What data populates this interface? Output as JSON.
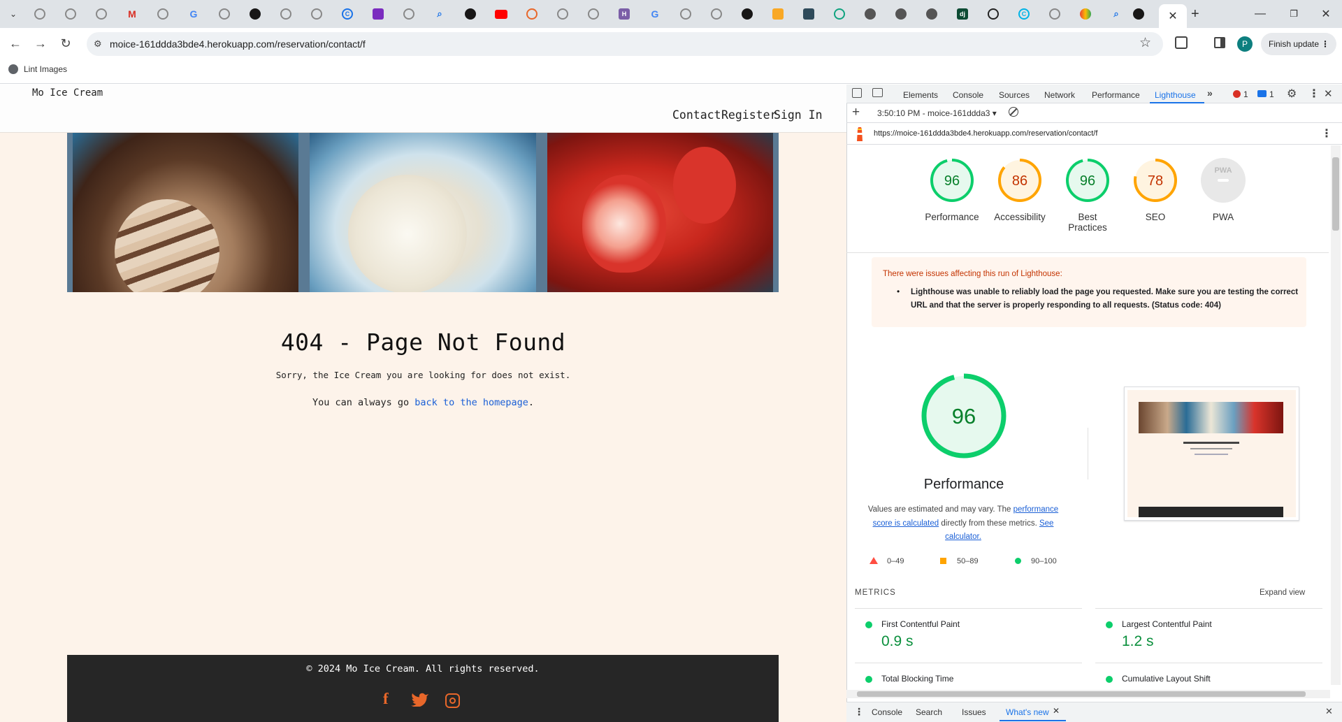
{
  "browser": {
    "url": "moice-161ddda3bde4.herokuapp.com/reservation/contact/f",
    "bookmark_label": "Lint Images",
    "finish_update_label": "Finish update",
    "profile_initial": "P"
  },
  "site": {
    "brand": "Mo Ice Cream",
    "nav": [
      "Contact",
      "Register",
      "Sign In"
    ],
    "heading": "404 - Page Not Found",
    "message": "Sorry, the Ice Cream you are looking for does not exist.",
    "back_prefix": "You can always go ",
    "back_link": "back to the homepage",
    "back_suffix": ".",
    "footer_text": "© 2024 Mo Ice Cream. All rights reserved."
  },
  "devtools": {
    "tabs": [
      "Elements",
      "Console",
      "Sources",
      "Network",
      "Performance",
      "Lighthouse"
    ],
    "error_count": "1",
    "message_count": "1",
    "report_selector": "3:50:10 PM - moice-161ddda3",
    "report_url": "https://moice-161ddda3bde4.herokuapp.com/reservation/contact/f",
    "scores": [
      {
        "value": "96",
        "label": "Performance",
        "color": "#0cce6b",
        "text": "#08802b",
        "bg": "#e6f9ee"
      },
      {
        "value": "86",
        "label": "Accessibility",
        "color": "#ffa400",
        "text": "#c33300",
        "bg": "#fff4e0"
      },
      {
        "value": "96",
        "label": "Best Practices",
        "color": "#0cce6b",
        "text": "#08802b",
        "bg": "#e6f9ee"
      },
      {
        "value": "78",
        "label": "SEO",
        "color": "#ffa400",
        "text": "#c33300",
        "bg": "#fff4e0"
      },
      {
        "value": "PWA",
        "label": "PWA",
        "color": "#e0e0e0",
        "text": "#aaa",
        "bg": "#e8e8e8"
      }
    ],
    "warning_title": "There were issues affecting this run of Lighthouse:",
    "warning_item": "Lighthouse was unable to reliably load the page you requested. Make sure you are testing the correct URL and that the server is properly responding to all requests. (Status code: 404)",
    "perf_score": "96",
    "perf_title": "Performance",
    "perf_desc_1": "Values are estimated and may vary. The ",
    "perf_link_1": "performance score is calculated",
    "perf_desc_2": " directly from these metrics. ",
    "perf_link_2": "See calculator.",
    "legend": [
      "0–49",
      "50–89",
      "90–100"
    ],
    "metrics_title": "METRICS",
    "expand_view": "Expand view",
    "metrics": [
      {
        "name": "First Contentful Paint",
        "value": "0.9 s"
      },
      {
        "name": "Largest Contentful Paint",
        "value": "1.2 s"
      },
      {
        "name": "Total Blocking Time",
        "value": ""
      },
      {
        "name": "Cumulative Layout Shift",
        "value": ""
      }
    ],
    "drawer_tabs": [
      "Console",
      "Search",
      "Issues",
      "What's new"
    ]
  },
  "colors": {
    "accent_blue": "#1a73e8",
    "page_bg": "#fdf3ea",
    "footer_bg": "#262626",
    "social_orange": "#e8672a"
  }
}
